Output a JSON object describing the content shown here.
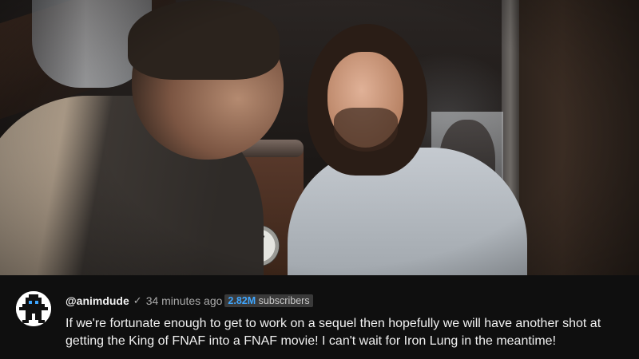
{
  "comment": {
    "handle": "@animdude",
    "verified_icon": "✓",
    "timestamp": "34 minutes ago",
    "subscriber_count": "2.82M",
    "subscriber_label": "subscribers",
    "text": "If we're fortunate enough to get to work on a sequel then hopefully we will have another shot at getting the King of FNAF into a FNAF movie! I can't wait for Iron Lung in the meantime!",
    "colors": {
      "background": "#0f0f0f",
      "text": "#f1f1f1",
      "muted": "#aaaaaa",
      "accent": "#3ea6ff"
    }
  },
  "avatar": {
    "icon": "pixel-character-icon"
  },
  "scene": {
    "icon": "movie-still-image"
  }
}
